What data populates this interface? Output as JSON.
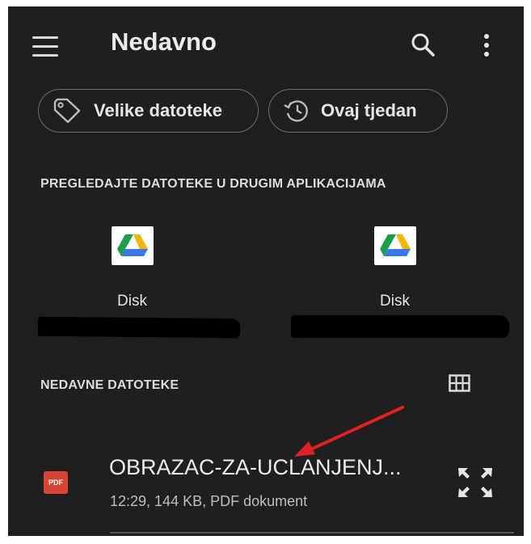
{
  "header": {
    "title": "Nedavno",
    "menu_icon": "hamburger-menu-icon",
    "search_icon": "search-icon",
    "more_icon": "more-vertical-icon"
  },
  "chips": [
    {
      "label": "Velike datoteke",
      "icon": "tag-icon"
    },
    {
      "label": "Ovaj tjedan",
      "icon": "history-icon"
    }
  ],
  "browse_section": {
    "heading": "PREGLEDAJTE DATOTEKE U DRUGIM APLIKACIJAMA",
    "apps": [
      {
        "label": "Disk",
        "icon": "google-drive-icon"
      },
      {
        "label": "Disk",
        "icon": "google-drive-icon"
      }
    ]
  },
  "recent_section": {
    "heading": "NEDAVNE DATOTEKE",
    "view_icon": "grid-view-icon",
    "files": [
      {
        "name": "OBRAZAC-ZA-UCLANJENJ...",
        "meta": "12:29, 144 KB, PDF dokument",
        "type_badge": "PDF",
        "action_icon": "expand-icon"
      }
    ]
  },
  "colors": {
    "background": "#1f1f1f",
    "text": "#e9e9e9",
    "pdf_badge": "#d64535",
    "annotation_arrow": "#e02020"
  }
}
